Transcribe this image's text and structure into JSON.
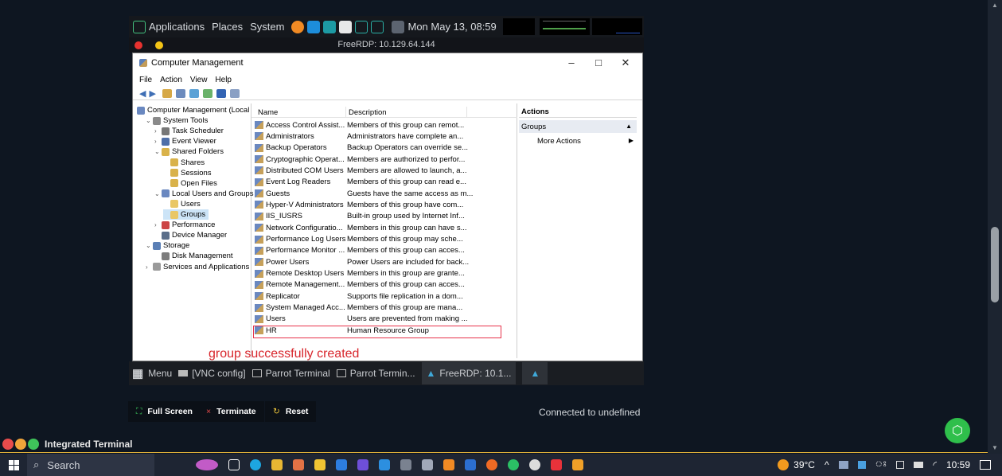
{
  "parrot_panel": {
    "applications": "Applications",
    "places": "Places",
    "system": "System",
    "clock": "Mon May 13, 08:59"
  },
  "rdp": {
    "title": "FreeRDP: 10.129.64.144"
  },
  "window": {
    "title": "Computer Management",
    "menu": [
      "File",
      "Action",
      "View",
      "Help"
    ]
  },
  "tree": [
    {
      "label": "Computer Management (Local",
      "icon": "computer-management-icon",
      "indent": 0,
      "exp": ""
    },
    {
      "label": "System Tools",
      "icon": "tools-icon",
      "indent": 1,
      "exp": "v"
    },
    {
      "label": "Task Scheduler",
      "icon": "clock-icon",
      "indent": 2,
      "exp": ">"
    },
    {
      "label": "Event Viewer",
      "icon": "event-viewer-icon",
      "indent": 2,
      "exp": ">"
    },
    {
      "label": "Shared Folders",
      "icon": "shared-folder-icon",
      "indent": 2,
      "exp": "v"
    },
    {
      "label": "Shares",
      "icon": "shared-folder-icon",
      "indent": 3,
      "exp": ""
    },
    {
      "label": "Sessions",
      "icon": "shared-folder-icon",
      "indent": 3,
      "exp": ""
    },
    {
      "label": "Open Files",
      "icon": "shared-folder-icon",
      "indent": 3,
      "exp": ""
    },
    {
      "label": "Local Users and Groups",
      "icon": "users-icon",
      "indent": 2,
      "exp": "v"
    },
    {
      "label": "Users",
      "icon": "folder-icon",
      "indent": 3,
      "exp": ""
    },
    {
      "label": "Groups",
      "icon": "folder-icon",
      "indent": 3,
      "exp": "",
      "selected": true
    },
    {
      "label": "Performance",
      "icon": "performance-icon",
      "indent": 2,
      "exp": ">"
    },
    {
      "label": "Device Manager",
      "icon": "device-manager-icon",
      "indent": 2,
      "exp": ""
    },
    {
      "label": "Storage",
      "icon": "storage-icon",
      "indent": 1,
      "exp": "v"
    },
    {
      "label": "Disk Management",
      "icon": "disk-icon",
      "indent": 2,
      "exp": ""
    },
    {
      "label": "Services and Applications",
      "icon": "services-icon",
      "indent": 1,
      "exp": ">"
    }
  ],
  "list": {
    "col_name": "Name",
    "col_desc": "Description",
    "rows": [
      {
        "name": "Access Control Assist...",
        "desc": "Members of this group can remot..."
      },
      {
        "name": "Administrators",
        "desc": "Administrators have complete an..."
      },
      {
        "name": "Backup Operators",
        "desc": "Backup Operators can override se..."
      },
      {
        "name": "Cryptographic Operat...",
        "desc": "Members are authorized to perfor..."
      },
      {
        "name": "Distributed COM Users",
        "desc": "Members are allowed to launch, a..."
      },
      {
        "name": "Event Log Readers",
        "desc": "Members of this group can read e..."
      },
      {
        "name": "Guests",
        "desc": "Guests have the same access as m..."
      },
      {
        "name": "Hyper-V Administrators",
        "desc": "Members of this group have com..."
      },
      {
        "name": "IIS_IUSRS",
        "desc": "Built-in group used by Internet Inf..."
      },
      {
        "name": "Network Configuratio...",
        "desc": "Members in this group can have s..."
      },
      {
        "name": "Performance Log Users",
        "desc": "Members of this group may sche..."
      },
      {
        "name": "Performance Monitor ...",
        "desc": "Members of this group can acces..."
      },
      {
        "name": "Power Users",
        "desc": "Power Users are included for back..."
      },
      {
        "name": "Remote Desktop Users",
        "desc": "Members in this group are grante..."
      },
      {
        "name": "Remote Management...",
        "desc": "Members of this group can acces..."
      },
      {
        "name": "Replicator",
        "desc": "Supports file replication in a dom..."
      },
      {
        "name": "System Managed Acc...",
        "desc": "Members of this group are mana..."
      },
      {
        "name": "Users",
        "desc": "Users are prevented from making ..."
      },
      {
        "name": "HR",
        "desc": "Human Resource Group"
      }
    ]
  },
  "actions": {
    "header": "Actions",
    "group": "Groups",
    "more": "More Actions"
  },
  "annotation": "group successfully created",
  "parrot_taskbar": {
    "menu": "Menu",
    "vnc": "[VNC config]",
    "term1": "Parrot Terminal",
    "term2": "Parrot Termin...",
    "freerdp": "FreeRDP: 10.1..."
  },
  "vnc": {
    "fullscreen": "Full Screen",
    "terminate": "Terminate",
    "reset": "Reset",
    "status": "Connected to undefined"
  },
  "integrated_terminal": "Integrated Terminal",
  "win_taskbar": {
    "search": "Search",
    "temp": "39°C",
    "time": "10:59"
  }
}
